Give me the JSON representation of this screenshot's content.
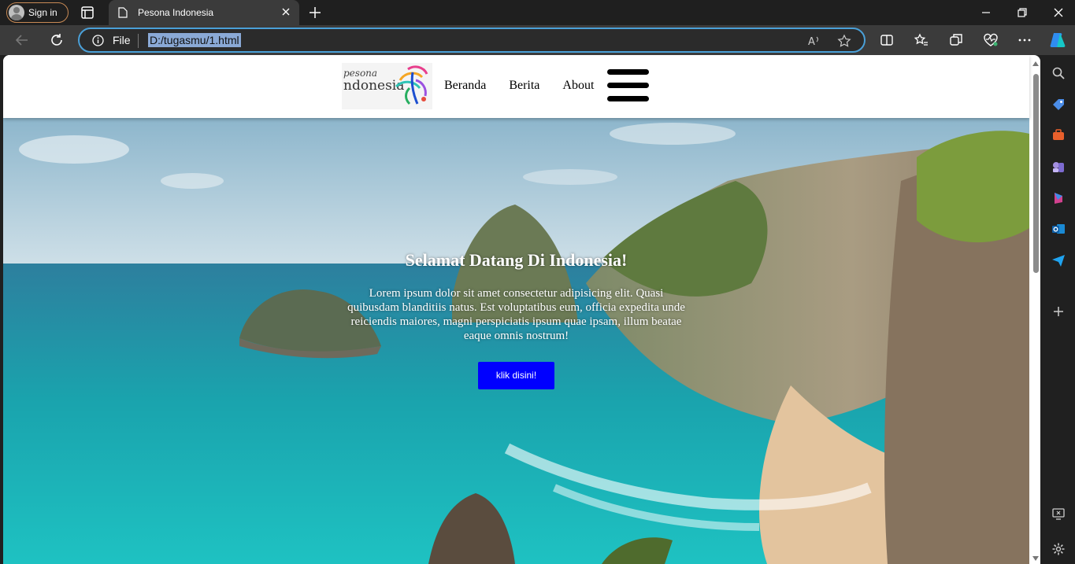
{
  "browser": {
    "sign_in_label": "Sign in",
    "tab_title": "Pesona Indonesia",
    "address_scheme_label": "File",
    "address_url": "D:/tugasmu/1.html"
  },
  "site": {
    "logo_line1": "pesona",
    "logo_line2": "ndonesia",
    "nav": [
      "Beranda",
      "Berita",
      "About"
    ],
    "hero_title": "Selamat Datang Di Indonesia!",
    "hero_text": "Lorem ipsum dolor sit amet consectetur adipisicing elit. Quasi quibusdam blanditiis natus. Est voluptatibus eum, officia expedita unde reiciendis maiores, magni perspiciatis ipsum quae ipsam, illum beatae eaque omnis nostrum!",
    "hero_button": "klik disini!",
    "button_color": "#0000ff"
  },
  "icons": {
    "browser": [
      "tabs-icon",
      "page-icon",
      "close-icon",
      "new-tab-icon",
      "minimize-icon",
      "restore-icon",
      "window-close-icon",
      "back-icon",
      "refresh-icon",
      "info-icon",
      "read-aloud-icon",
      "favorite-star-icon",
      "split-screen-icon",
      "favorites-icon",
      "collections-icon",
      "health-icon",
      "more-icon",
      "copilot-icon"
    ],
    "sidebar": [
      "search-icon",
      "shopping-icon",
      "tools-icon",
      "games-icon",
      "office-icon",
      "outlook-icon",
      "send-icon",
      "add-icon",
      "screenshot-icon",
      "settings-icon"
    ]
  }
}
